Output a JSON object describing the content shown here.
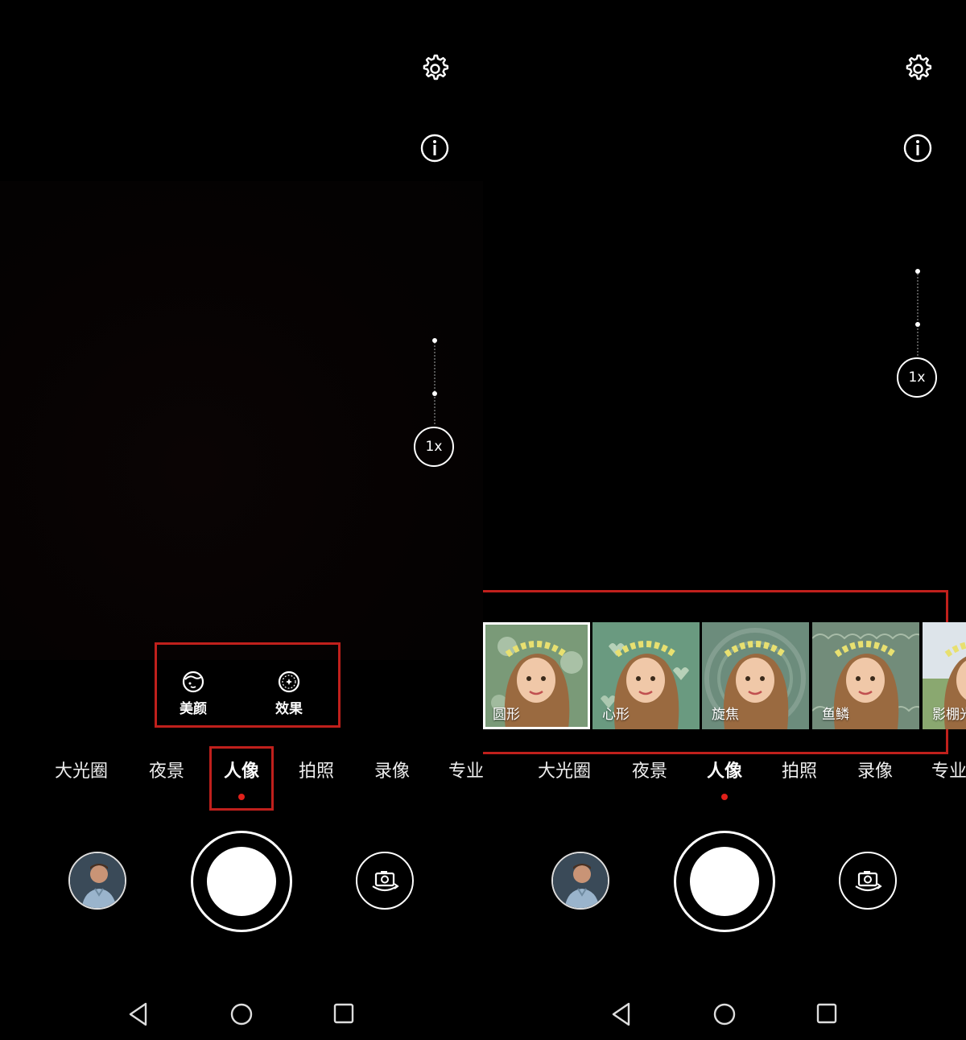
{
  "zoom_label": "1x",
  "quick_controls": {
    "beauty_label": "美颜",
    "effects_label": "效果"
  },
  "modes": [
    {
      "label": "大光圈",
      "active": false
    },
    {
      "label": "夜景",
      "active": false
    },
    {
      "label": "人像",
      "active": true
    },
    {
      "label": "拍照",
      "active": false
    },
    {
      "label": "录像",
      "active": false
    },
    {
      "label": "专业",
      "active": false
    }
  ],
  "effects": [
    {
      "label": "圆形",
      "selected": true
    },
    {
      "label": "心形",
      "selected": false
    },
    {
      "label": "旋焦",
      "selected": false
    },
    {
      "label": "鱼鳞",
      "selected": false
    },
    {
      "label": "影棚光",
      "selected": false
    }
  ],
  "colors": {
    "accent": "#e0201a",
    "highlight_box": "#c0201c",
    "background": "#000000"
  },
  "icons": {
    "settings": "gear-icon",
    "info": "info-icon",
    "beauty": "face-icon",
    "effects": "aperture-icon",
    "gallery": "gallery-thumbnail",
    "switch_camera": "camera-switch-icon",
    "nav_back": "back-icon",
    "nav_home": "home-icon",
    "nav_recent": "recent-apps-icon"
  }
}
